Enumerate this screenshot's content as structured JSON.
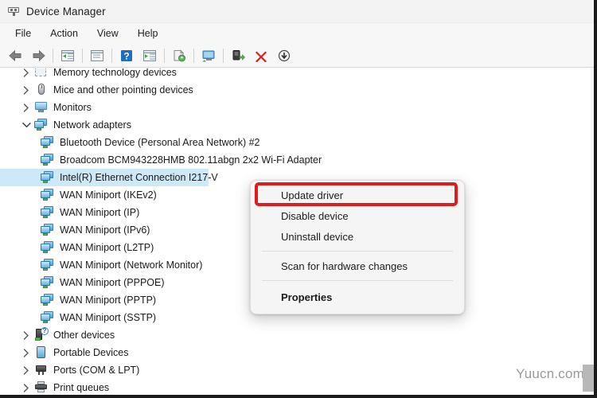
{
  "window": {
    "title": "Device Manager",
    "icon": "device-manager-icon"
  },
  "menubar": {
    "items": [
      {
        "label": "File"
      },
      {
        "label": "Action"
      },
      {
        "label": "View"
      },
      {
        "label": "Help"
      }
    ]
  },
  "toolbar": {
    "buttons": [
      {
        "name": "back-button",
        "icon": "left-arrow-icon",
        "tooltip": "Back"
      },
      {
        "name": "forward-button",
        "icon": "right-arrow-icon",
        "tooltip": "Forward"
      },
      {
        "name": "show-hide-console-tree-button",
        "icon": "console-tree-icon",
        "tooltip": "Show/Hide Console Tree"
      },
      {
        "name": "properties-button",
        "icon": "properties-window-icon",
        "tooltip": "Properties"
      },
      {
        "name": "help-button",
        "icon": "help-question-icon",
        "tooltip": "Help"
      },
      {
        "name": "show-detail-pane-button",
        "icon": "detail-pane-icon",
        "tooltip": "Show Details"
      },
      {
        "name": "update-driver-button",
        "icon": "update-driver-icon",
        "tooltip": "Update driver"
      },
      {
        "name": "scan-hardware-changes-button",
        "icon": "scan-monitor-icon",
        "tooltip": "Scan for hardware changes"
      },
      {
        "name": "enable-device-button",
        "icon": "enable-device-icon",
        "tooltip": "Enable device"
      },
      {
        "name": "uninstall-device-button",
        "icon": "red-x-icon",
        "tooltip": "Uninstall device"
      },
      {
        "name": "disable-device-button",
        "icon": "down-arrow-circle-icon",
        "tooltip": "Disable device"
      }
    ]
  },
  "tree": {
    "items": [
      {
        "label": "Memory technology devices",
        "indent": 0,
        "expander": "collapsed",
        "icon": "memory-technology-icon",
        "selected": false
      },
      {
        "label": "Mice and other pointing devices",
        "indent": 0,
        "expander": "collapsed",
        "icon": "mouse-icon",
        "selected": false
      },
      {
        "label": "Monitors",
        "indent": 0,
        "expander": "collapsed",
        "icon": "monitor-icon",
        "selected": false
      },
      {
        "label": "Network adapters",
        "indent": 0,
        "expander": "expanded",
        "icon": "network-adapter-icon",
        "selected": false
      },
      {
        "label": "Bluetooth Device (Personal Area Network) #2",
        "indent": 1,
        "expander": "none",
        "icon": "network-adapter-icon",
        "selected": false
      },
      {
        "label": "Broadcom BCM943228HMB 802.11abgn 2x2 Wi-Fi Adapter",
        "indent": 1,
        "expander": "none",
        "icon": "network-adapter-icon",
        "selected": false
      },
      {
        "label": "Intel(R) Ethernet Connection I217-V",
        "indent": 1,
        "expander": "none",
        "icon": "network-adapter-icon",
        "selected": true
      },
      {
        "label": "WAN Miniport (IKEv2)",
        "indent": 1,
        "expander": "none",
        "icon": "network-adapter-icon",
        "selected": false
      },
      {
        "label": "WAN Miniport (IP)",
        "indent": 1,
        "expander": "none",
        "icon": "network-adapter-icon",
        "selected": false
      },
      {
        "label": "WAN Miniport (IPv6)",
        "indent": 1,
        "expander": "none",
        "icon": "network-adapter-icon",
        "selected": false
      },
      {
        "label": "WAN Miniport (L2TP)",
        "indent": 1,
        "expander": "none",
        "icon": "network-adapter-icon",
        "selected": false
      },
      {
        "label": "WAN Miniport (Network Monitor)",
        "indent": 1,
        "expander": "none",
        "icon": "network-adapter-icon",
        "selected": false
      },
      {
        "label": "WAN Miniport (PPPOE)",
        "indent": 1,
        "expander": "none",
        "icon": "network-adapter-icon",
        "selected": false
      },
      {
        "label": "WAN Miniport (PPTP)",
        "indent": 1,
        "expander": "none",
        "icon": "network-adapter-icon",
        "selected": false
      },
      {
        "label": "WAN Miniport (SSTP)",
        "indent": 1,
        "expander": "none",
        "icon": "network-adapter-icon",
        "selected": false
      },
      {
        "label": "Other devices",
        "indent": 0,
        "expander": "collapsed",
        "icon": "other-devices-warning-icon",
        "selected": false
      },
      {
        "label": "Portable Devices",
        "indent": 0,
        "expander": "collapsed",
        "icon": "portable-device-icon",
        "selected": false
      },
      {
        "label": "Ports (COM & LPT)",
        "indent": 0,
        "expander": "collapsed",
        "icon": "ports-icon",
        "selected": false
      },
      {
        "label": "Print queues",
        "indent": 0,
        "expander": "collapsed",
        "icon": "printer-icon",
        "selected": false
      }
    ]
  },
  "context_menu": {
    "items": [
      {
        "label": "Update driver",
        "bold": false,
        "highlighted": true
      },
      {
        "label": "Disable device",
        "bold": false,
        "highlighted": false
      },
      {
        "label": "Uninstall device",
        "bold": false,
        "highlighted": false
      },
      {
        "separator": true
      },
      {
        "label": "Scan for hardware changes",
        "bold": false,
        "highlighted": false
      },
      {
        "separator": true
      },
      {
        "label": "Properties",
        "bold": true,
        "highlighted": false
      }
    ],
    "highlight_color": "#e01b1b"
  },
  "watermark": {
    "text": "Yuucn.com"
  }
}
